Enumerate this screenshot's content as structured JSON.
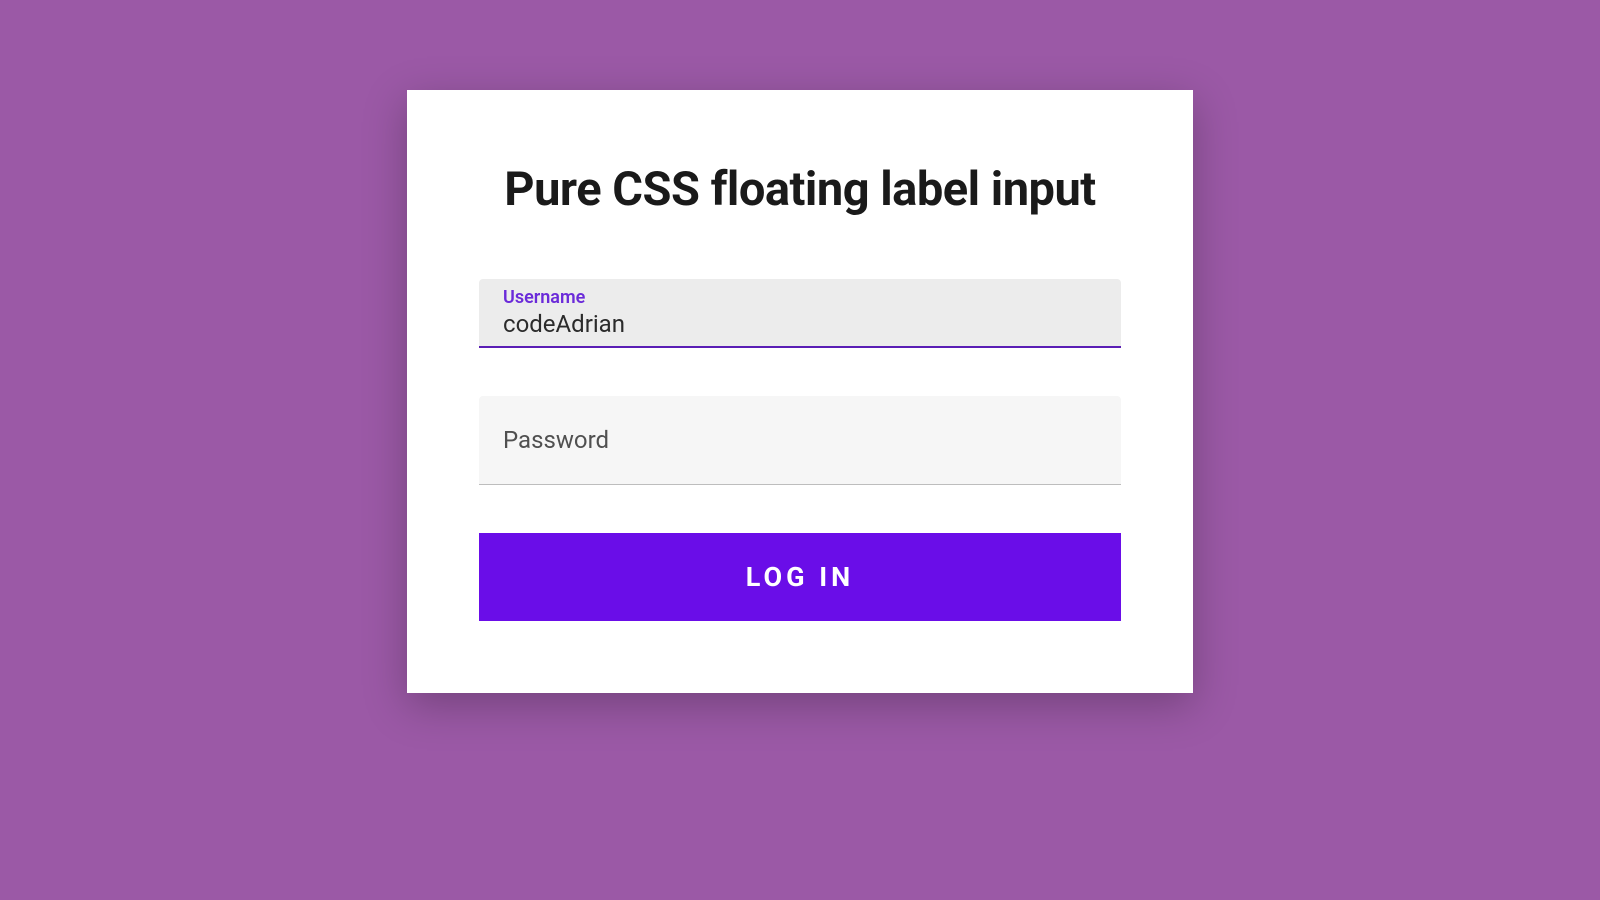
{
  "page": {
    "title": "Pure CSS floating label input"
  },
  "form": {
    "username": {
      "label": "Username",
      "value": "codeAdrian"
    },
    "password": {
      "label": "Password",
      "value": ""
    },
    "submit": {
      "label": "LOG IN"
    }
  },
  "colors": {
    "page_bg": "#9b59a6",
    "accent": "#6a0de8",
    "label_active": "#6b2bd9"
  }
}
